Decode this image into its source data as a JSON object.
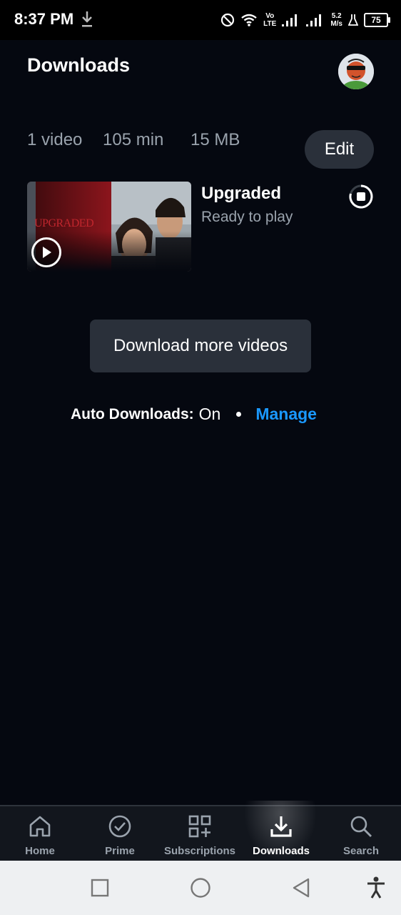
{
  "status_bar": {
    "time": "8:37 PM",
    "volte_top": "Vo",
    "volte_bottom": "LTE",
    "speed_value": "5.2",
    "speed_unit": "M/s",
    "battery": "75"
  },
  "header": {
    "title": "Downloads"
  },
  "summary": {
    "videos": "1 video",
    "minutes": "105 min",
    "size": "15 MB",
    "edit_label": "Edit"
  },
  "downloads": [
    {
      "title": "Upgraded",
      "status": "Ready to play",
      "poster_text": "UPGRADED"
    }
  ],
  "download_more_label": "Download more videos",
  "auto_downloads": {
    "label": "Auto Downloads:",
    "state": "On",
    "manage_label": "Manage"
  },
  "bottom_nav": {
    "items": [
      {
        "label": "Home",
        "icon": "home-icon"
      },
      {
        "label": "Prime",
        "icon": "check-circle-icon"
      },
      {
        "label": "Subscriptions",
        "icon": "grid-plus-icon"
      },
      {
        "label": "Downloads",
        "icon": "download-icon",
        "active": true
      },
      {
        "label": "Search",
        "icon": "search-icon"
      }
    ]
  },
  "colors": {
    "background": "#050810",
    "accent": "#1a98ff",
    "button_bg": "#2a303a",
    "muted_text": "#9aa3ad"
  }
}
